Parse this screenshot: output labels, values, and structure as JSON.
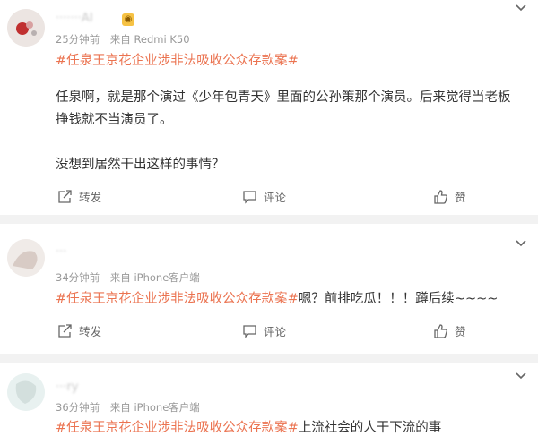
{
  "posts": [
    {
      "username": "·······AI",
      "meta": {
        "time": "25分钟前",
        "source": "来自 Redmi K50"
      },
      "topic": "#任泉王京花企业涉非法吸收公众存款案#",
      "paragraphs": [
        "任泉啊，就是那个演过《少年包青天》里面的公孙策那个演员。后来觉得当老板挣钱就不当演员了。",
        "没想到居然干出这样的事情？"
      ],
      "actions": {
        "repost": "转发",
        "comment": "评论",
        "like": "赞"
      },
      "colors": {
        "avatar_bg": "#eae3e0",
        "avatar_fg": "#c03030"
      }
    },
    {
      "username": "···",
      "meta": {
        "time": "34分钟前",
        "source": "来自 iPhone客户端"
      },
      "topic": "#任泉王京花企业涉非法吸收公众存款案#",
      "text": "嗯？前排吃瓜！！！蹲后续~~~~",
      "actions": {
        "repost": "转发",
        "comment": "评论",
        "like": "赞"
      },
      "colors": {
        "avatar_bg": "#efe9e6",
        "avatar_fg": "#cfbfb8"
      }
    },
    {
      "username": "···ry",
      "meta": {
        "time": "36分钟前",
        "source": "来自 iPhone客户端"
      },
      "topic": "#任泉王京花企业涉非法吸收公众存款案#",
      "text": "上流社会的人干下流的事",
      "colors": {
        "avatar_bg": "#e6f0ef",
        "avatar_fg": "#cfdad8"
      }
    }
  ],
  "icons": [
    "chevron-down-icon",
    "repost-icon",
    "comment-icon",
    "like-icon"
  ]
}
